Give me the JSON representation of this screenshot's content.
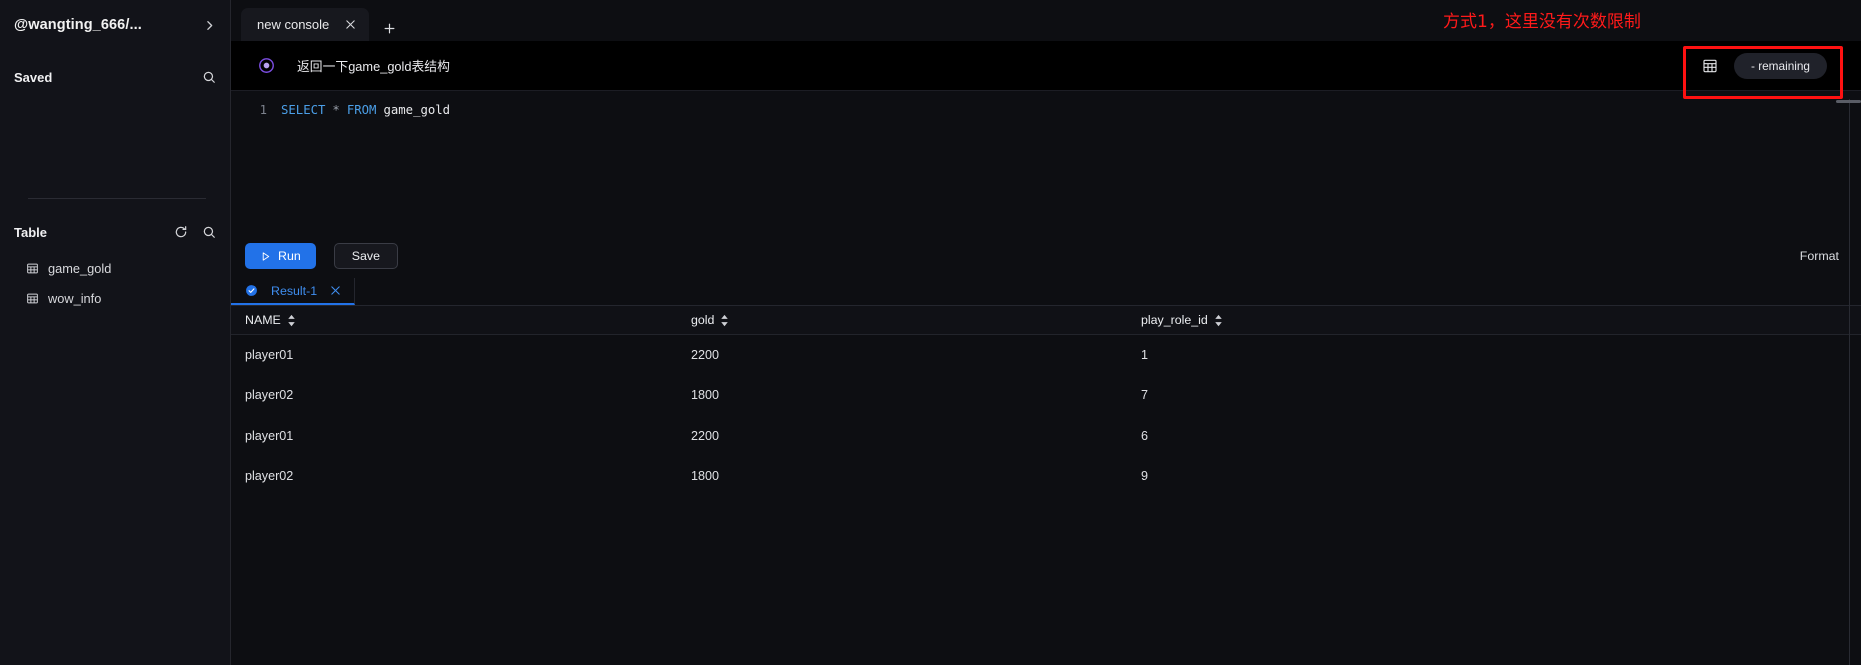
{
  "sidebar": {
    "account_label": "@wangting_666/...",
    "account_chevron_icon": "chevron-right-icon",
    "saved": {
      "title": "Saved",
      "search_icon": "search-icon"
    },
    "table_section": {
      "title": "Table",
      "refresh_icon": "refresh-icon",
      "search_icon": "search-icon",
      "items": [
        {
          "name": "game_gold",
          "icon": "table-icon"
        },
        {
          "name": "wow_info",
          "icon": "table-icon"
        }
      ]
    }
  },
  "tabstrip": {
    "tabs": [
      {
        "label": "new console",
        "close_icon": "close-icon",
        "active": true
      }
    ],
    "add_tab_icon": "plus-icon"
  },
  "prompt_bar": {
    "ai_icon": "ai-target-icon",
    "text": "返回一下game_gold表结构",
    "grid_icon": "table-grid-icon",
    "remaining_badge": "- remaining"
  },
  "editor": {
    "lines": [
      {
        "number": "1",
        "tokens": [
          {
            "text": "SELECT",
            "type": "keyword"
          },
          {
            "text": "*",
            "type": "operator"
          },
          {
            "text": "FROM",
            "type": "keyword"
          },
          {
            "text": "game_gold",
            "type": "identifier"
          }
        ]
      }
    ]
  },
  "actions": {
    "run_label": "Run",
    "run_icon": "play-icon",
    "save_label": "Save",
    "format_label": "Format"
  },
  "result_tabs": [
    {
      "label": "Result-1",
      "status_icon": "check-circle-icon",
      "close_icon": "close-icon"
    }
  ],
  "result_grid": {
    "columns": [
      {
        "label": "NAME",
        "sort_icon": "sort-arrows-icon"
      },
      {
        "label": "gold",
        "sort_icon": "sort-arrows-icon"
      },
      {
        "label": "play_role_id",
        "sort_icon": "sort-arrows-icon"
      }
    ],
    "rows": [
      {
        "NAME": "player01",
        "gold": "2200",
        "play_role_id": "1"
      },
      {
        "NAME": "player02",
        "gold": "1800",
        "play_role_id": "7"
      },
      {
        "NAME": "player01",
        "gold": "2200",
        "play_role_id": "6"
      },
      {
        "NAME": "player02",
        "gold": "1800",
        "play_role_id": "9"
      }
    ]
  },
  "annotations": {
    "note_text": "方式1，这里没有次数限制",
    "note_color": "#ff1a1a",
    "highlight_box_color": "#ff1111"
  },
  "colors": {
    "accent_blue": "#2272e8",
    "background": "#0d0e12",
    "sidebar_background": "#121319",
    "prompt_background": "#000000"
  }
}
